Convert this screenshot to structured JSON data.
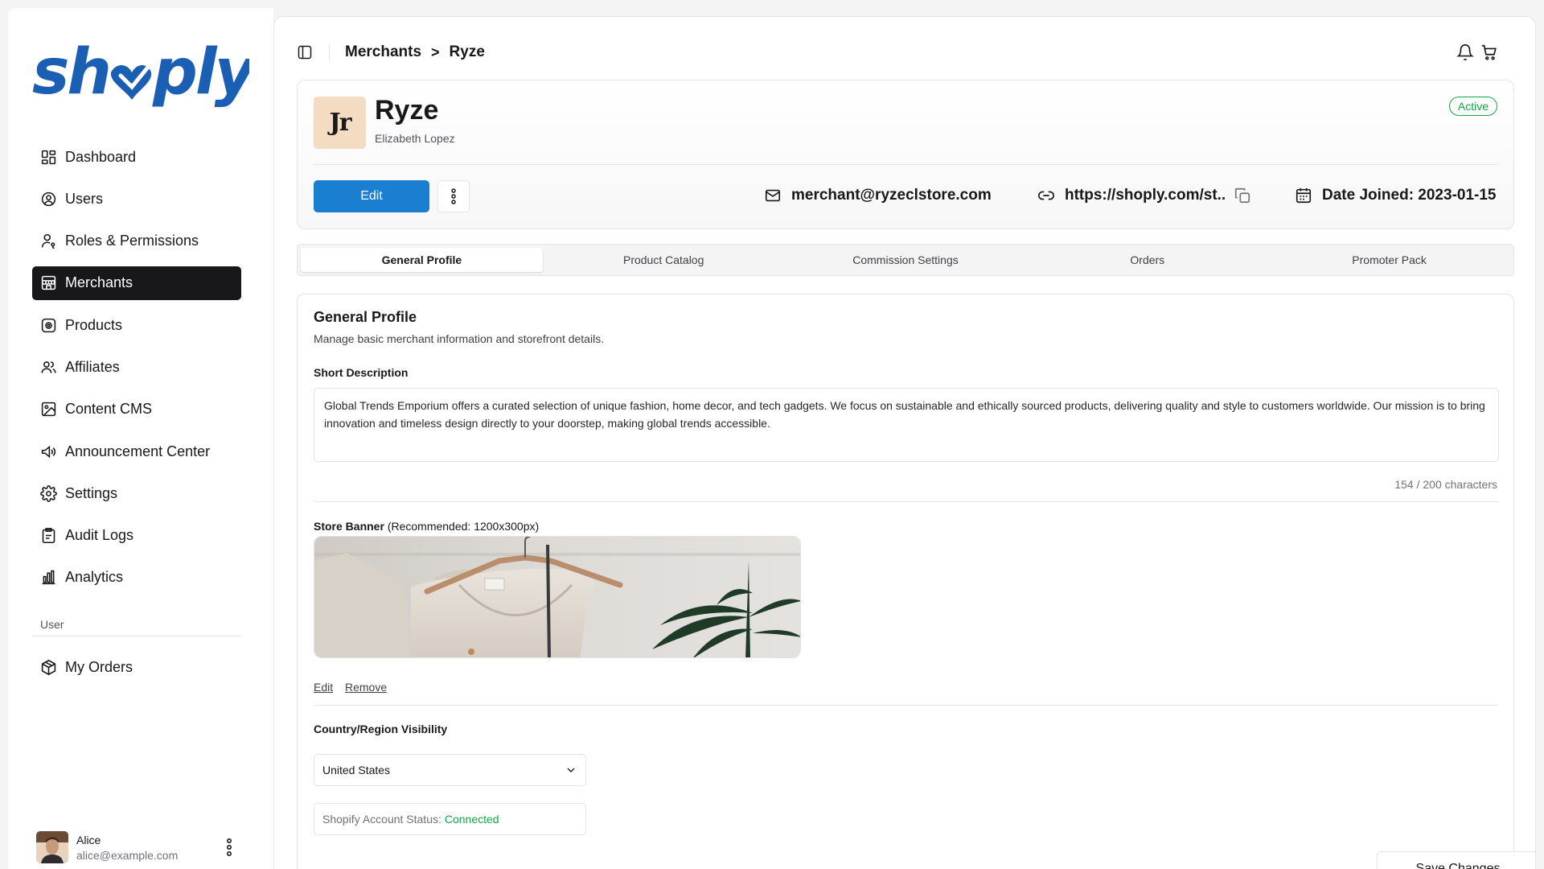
{
  "brand": {
    "name": "shoply",
    "color": "#1a5fb4"
  },
  "sidebar": {
    "items": [
      {
        "label": "Dashboard",
        "icon": "dashboard-icon"
      },
      {
        "label": "Users",
        "icon": "user-circle-icon"
      },
      {
        "label": "Roles & Permissions",
        "icon": "user-key-icon"
      },
      {
        "label": "Merchants",
        "icon": "store-icon",
        "active": true
      },
      {
        "label": "Products",
        "icon": "product-icon"
      },
      {
        "label": "Affiliates",
        "icon": "users-icon"
      },
      {
        "label": "Content CMS",
        "icon": "image-icon"
      },
      {
        "label": "Announcement Center",
        "icon": "megaphone-icon"
      },
      {
        "label": "Settings",
        "icon": "gear-icon"
      },
      {
        "label": "Audit Logs",
        "icon": "clipboard-icon"
      },
      {
        "label": "Analytics",
        "icon": "bar-chart-icon"
      }
    ],
    "section_label": "User",
    "user_items": [
      {
        "label": "My Orders",
        "icon": "package-icon"
      }
    ],
    "user": {
      "name": "Alice",
      "email": "alice@example.com"
    }
  },
  "topbar": {
    "breadcrumb": [
      "Merchants",
      "Ryze"
    ],
    "breadcrumb_separator": ">"
  },
  "merchant": {
    "logo_text": "Jr",
    "name": "Ryze",
    "owner": "Elizabeth Lopez",
    "status": "Active",
    "email": "merchant@ryzeclstore.com",
    "url": "https://shoply.com/st..",
    "date_joined": "Date Joined: 2023-01-15",
    "edit_label": "Edit"
  },
  "tabs": [
    "General Profile",
    "Product Catalog",
    "Commission Settings",
    "Orders",
    "Promoter Pack"
  ],
  "active_tab": "General Profile",
  "general_profile": {
    "title": "General Profile",
    "subtitle": "Manage basic merchant information and storefront details.",
    "short_description_label": "Short Description",
    "short_description": "Global Trends Emporium offers a curated selection of unique fashion, home decor, and tech gadgets. We focus on sustainable and ethically sourced products, delivering quality and style to customers worldwide. Our mission is to bring innovation and timeless design directly to your doorstep, making global trends accessible.",
    "char_count": "154 / 200 characters",
    "banner_label": "Store Banner",
    "banner_hint": "(Recommended: 1200x300px)",
    "banner_edit": "Edit",
    "banner_remove": "Remove",
    "country_label": "Country/Region Visibility",
    "country_value": "United States",
    "shopify_status_label": "Shopify Account Status:",
    "shopify_status_value": "Connected",
    "save_label": "Save Changes"
  },
  "colors": {
    "accent": "#1a7fd0",
    "success": "#16a34a",
    "nav_active": "#18181b"
  }
}
